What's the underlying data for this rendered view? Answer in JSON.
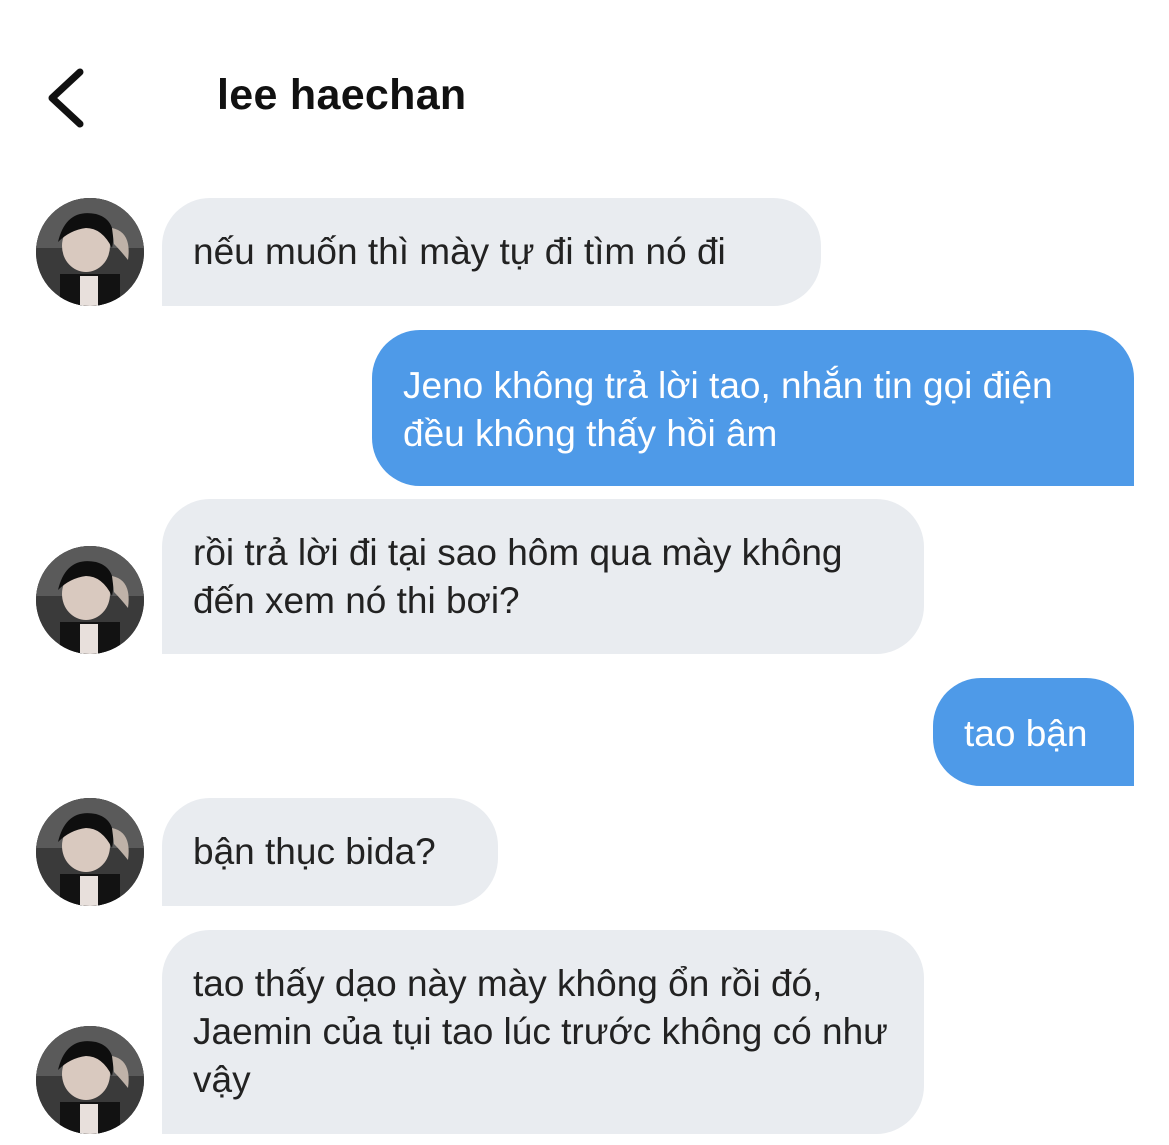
{
  "header": {
    "back_icon": "chevron-left-icon",
    "title": "lee haechan"
  },
  "colors": {
    "incoming_bubble": "#e9ecf0",
    "outgoing_bubble": "#4e9ae8",
    "outgoing_text": "#ffffff",
    "background": "#ffffff"
  },
  "messages": [
    {
      "sender": "lee haechan",
      "side": "incoming",
      "text": "nếu muốn thì mày tự đi tìm nó đi"
    },
    {
      "sender": "me",
      "side": "outgoing",
      "text": "Jeno không trả lời tao, nhắn tin gọi điện đều không thấy hồi âm"
    },
    {
      "sender": "lee haechan",
      "side": "incoming",
      "text": "rồi trả lời đi tại sao hôm qua mày không đến xem nó thi bơi?"
    },
    {
      "sender": "me",
      "side": "outgoing",
      "text": "tao bận"
    },
    {
      "sender": "lee haechan",
      "side": "incoming",
      "text": "bận thục bida?"
    },
    {
      "sender": "lee haechan",
      "side": "incoming",
      "text": "tao thấy dạo này mày không ổn rồi đó, Jaemin của tụi tao lúc trước không có như vậy"
    }
  ]
}
